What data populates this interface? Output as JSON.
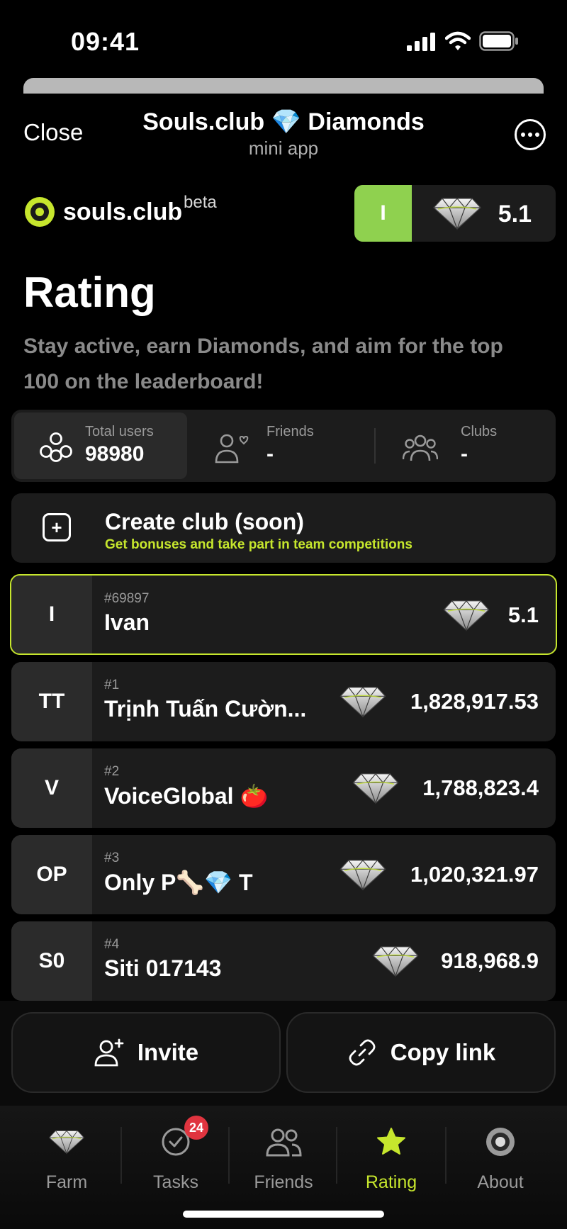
{
  "status_bar": {
    "time": "09:41"
  },
  "header": {
    "close_label": "Close",
    "title": "Souls.club 💎 Diamonds",
    "subtitle": "mini app"
  },
  "brand": {
    "name": "souls.club",
    "tag": "beta"
  },
  "balance": {
    "avatar_initial": "I",
    "value": "5.1"
  },
  "page": {
    "title": "Rating",
    "description": "Stay active, earn Diamonds, and aim for the top 100 on the leaderboard!"
  },
  "stats": [
    {
      "label": "Total users",
      "value": "98980",
      "icon": "users-group-icon"
    },
    {
      "label": "Friends",
      "value": "-",
      "icon": "friend-heart-icon"
    },
    {
      "label": "Clubs",
      "value": "-",
      "icon": "clubs-icon"
    }
  ],
  "create_club": {
    "title": "Create club (soon)",
    "subtitle": "Get bonuses and take part in team competitions"
  },
  "current_user": {
    "initials": "I",
    "position": "#69897",
    "name": "Ivan",
    "score": "5.1"
  },
  "leaderboard": [
    {
      "initials": "TT",
      "position": "#1",
      "name": "Trịnh Tuấn Cườn...",
      "score": "1,828,917.53"
    },
    {
      "initials": "V",
      "position": "#2",
      "name": "VoiceGlobal 🍅",
      "score": "1,788,823.4"
    },
    {
      "initials": "OP",
      "position": "#3",
      "name": "Only P🦴💎 T",
      "score": "1,020,321.97"
    },
    {
      "initials": "S0",
      "position": "#4",
      "name": "Siti 017143",
      "score": "918,968.9"
    }
  ],
  "actions": {
    "invite_label": "Invite",
    "copy_label": "Copy link"
  },
  "tabs": [
    {
      "label": "Farm",
      "icon": "diamond-icon"
    },
    {
      "label": "Tasks",
      "icon": "check-circle-icon",
      "badge": "24"
    },
    {
      "label": "Friends",
      "icon": "friends-icon"
    },
    {
      "label": "Rating",
      "icon": "star-icon"
    },
    {
      "label": "About",
      "icon": "about-icon"
    }
  ],
  "colors": {
    "accent": "#c6e62d",
    "avatar_green": "#8fd14f",
    "badge_red": "#e0343f",
    "card": "#1c1c1c"
  }
}
